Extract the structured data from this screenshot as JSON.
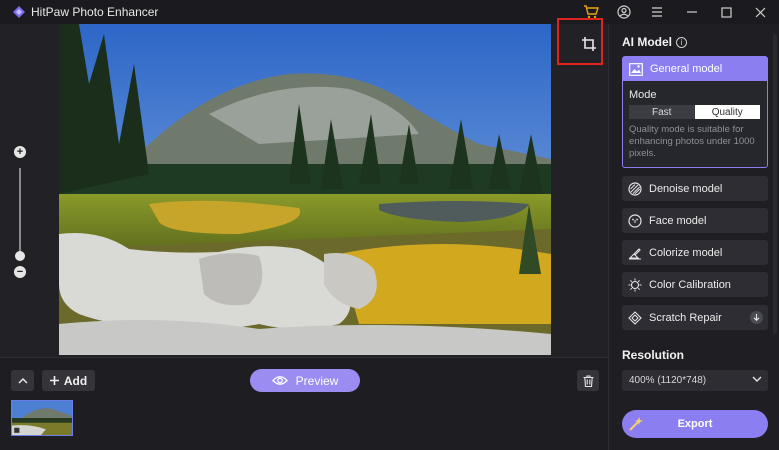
{
  "app": {
    "title": "HitPaw Photo Enhancer"
  },
  "titlebar": {
    "icons": [
      "cart-icon",
      "account-icon",
      "menu-icon",
      "minimize-icon",
      "maximize-icon",
      "close-icon"
    ]
  },
  "toolbar": {
    "add_label": "Add",
    "preview_label": "Preview"
  },
  "panel": {
    "title": "AI Model",
    "general": {
      "label": "General model",
      "mode_label": "Mode",
      "mode_options": [
        "Fast",
        "Quality"
      ],
      "selected_mode": "Quality",
      "description": "Quality mode is suitable for enhancing photos under 1000 pixels."
    },
    "models": [
      {
        "label": "Denoise model",
        "icon": "denoise-icon"
      },
      {
        "label": "Face model",
        "icon": "face-icon"
      },
      {
        "label": "Colorize model",
        "icon": "colorize-icon"
      },
      {
        "label": "Color Calibration",
        "icon": "color-calibration-icon"
      },
      {
        "label": "Scratch Repair",
        "icon": "scratch-repair-icon"
      }
    ],
    "resolution_title": "Resolution",
    "resolution_value": "400% (1120*748)",
    "export_label": "Export"
  },
  "colors": {
    "accent": "#8b7ef0",
    "highlight": "#e0231c",
    "cart": "#e8a317"
  }
}
